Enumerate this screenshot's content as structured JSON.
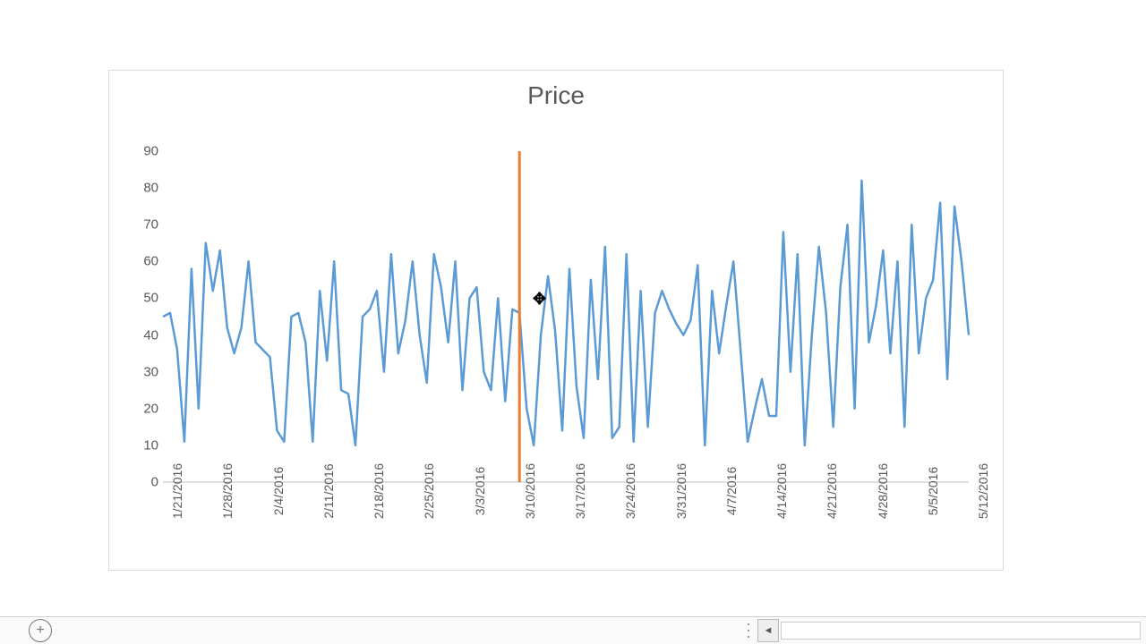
{
  "chart_data": {
    "type": "line",
    "title": "Price",
    "ylabel": "",
    "xlabel": "",
    "ylim": [
      0,
      90
    ],
    "y_ticks": [
      0,
      10,
      20,
      30,
      40,
      50,
      60,
      70,
      80,
      90
    ],
    "x_tick_labels": [
      "1/21/2016",
      "1/28/2016",
      "2/4/2016",
      "2/11/2016",
      "2/18/2016",
      "2/25/2016",
      "3/3/2016",
      "3/10/2016",
      "3/17/2016",
      "3/24/2016",
      "3/31/2016",
      "4/7/2016",
      "4/14/2016",
      "4/21/2016",
      "4/28/2016",
      "5/5/2016",
      "5/12/2016"
    ],
    "vertical_marker_index": 50,
    "series": [
      {
        "name": "Price",
        "color": "#5b9bd5",
        "values": [
          45,
          46,
          36,
          11,
          58,
          20,
          65,
          52,
          63,
          42,
          35,
          42,
          60,
          38,
          36,
          34,
          14,
          11,
          45,
          46,
          38,
          11,
          52,
          33,
          60,
          25,
          24,
          10,
          45,
          47,
          52,
          30,
          62,
          35,
          44,
          60,
          40,
          27,
          62,
          53,
          38,
          60,
          25,
          50,
          53,
          30,
          25,
          50,
          22,
          47,
          46,
          20,
          10,
          40,
          56,
          41,
          14,
          58,
          26,
          12,
          55,
          28,
          64,
          12,
          15,
          62,
          11,
          52,
          15,
          46,
          52,
          47,
          43,
          40,
          44,
          59,
          10,
          52,
          35,
          48,
          60,
          36,
          11,
          20,
          28,
          18,
          18,
          68,
          30,
          62,
          10,
          40,
          64,
          46,
          15,
          53,
          70,
          20,
          82,
          38,
          48,
          63,
          35,
          60,
          15,
          70,
          35,
          50,
          55,
          76,
          28,
          75,
          60,
          40
        ]
      }
    ]
  },
  "cursor": {
    "glyph": "✥"
  },
  "bottom_bar": {
    "add_sheet_label": "+",
    "scroll_left_label": "◄"
  }
}
